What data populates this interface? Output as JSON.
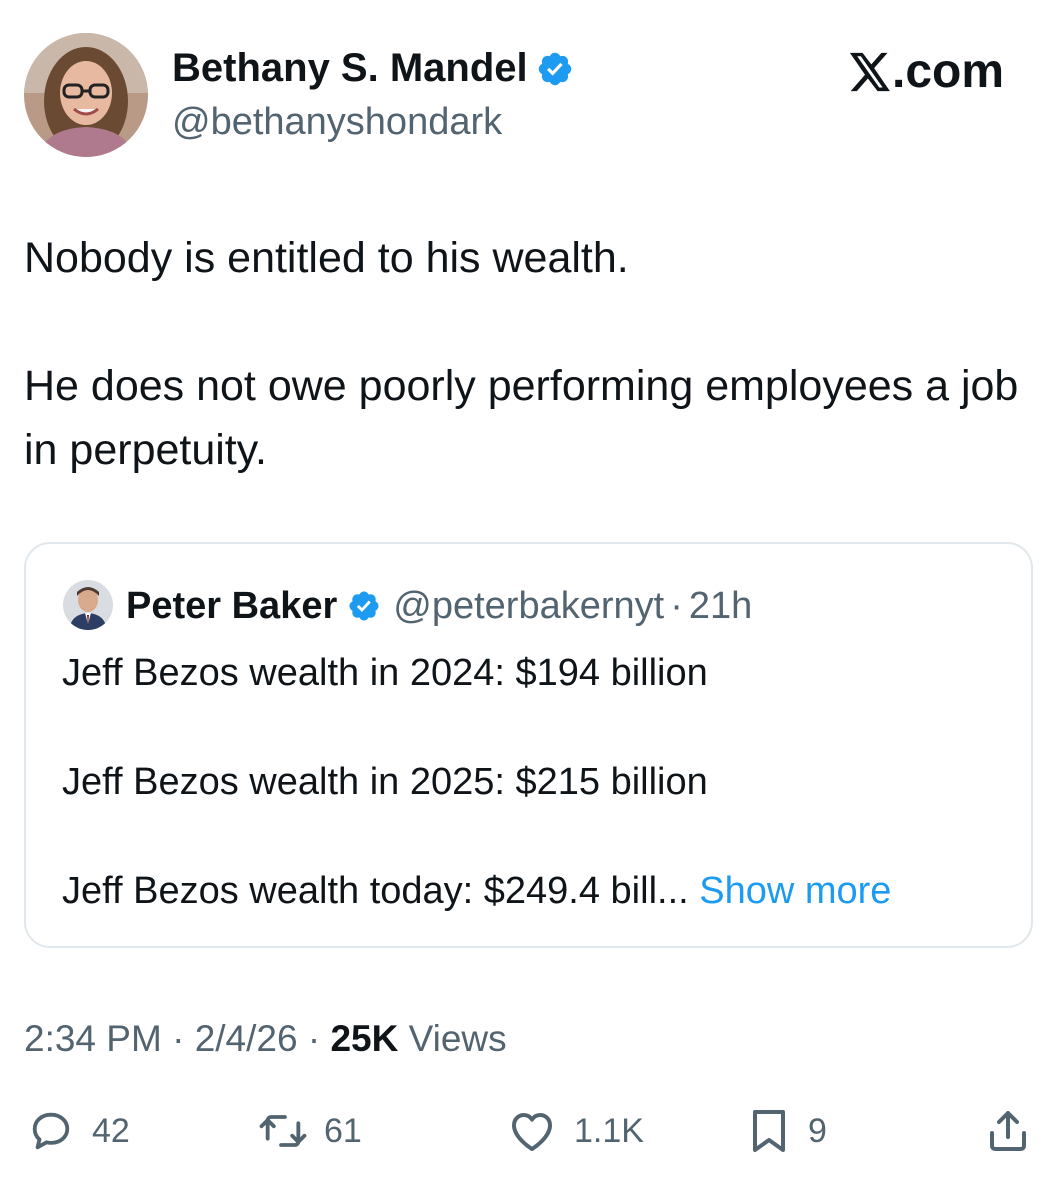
{
  "author": {
    "name": "Bethany S. Mandel",
    "handle": "@bethanyshondark"
  },
  "brand": {
    "logo_text": ".com"
  },
  "tweet": {
    "paragraph_1": "Nobody is entitled to his wealth.",
    "paragraph_2": "He does not owe poorly performing employees a job in perpetuity."
  },
  "quote": {
    "name": "Peter Baker",
    "handle": "@peterbakernyt",
    "separator": "·",
    "time": "21h",
    "line_1": "Jeff Bezos wealth in 2024: $194 billion",
    "line_2": "Jeff Bezos wealth in 2025: $215 billion",
    "line_3": "Jeff Bezos wealth today: $249.4 bill...",
    "show_more": "Show more"
  },
  "meta": {
    "time": "2:34 PM",
    "sep1": " · ",
    "date": "2/4/26",
    "sep2": " · ",
    "views_count": "25K",
    "views_label": " Views"
  },
  "actions": {
    "replies": "42",
    "reposts": "61",
    "likes": "1.1K",
    "bookmarks": "9"
  },
  "icons": {
    "verified_color": "#1d9bf0",
    "secondary_text_color": "#536471",
    "link_color": "#1d9bf0",
    "reply": "reply-icon",
    "repost": "repost-icon",
    "like": "heart-icon",
    "bookmark": "bookmark-icon",
    "share": "share-icon"
  }
}
